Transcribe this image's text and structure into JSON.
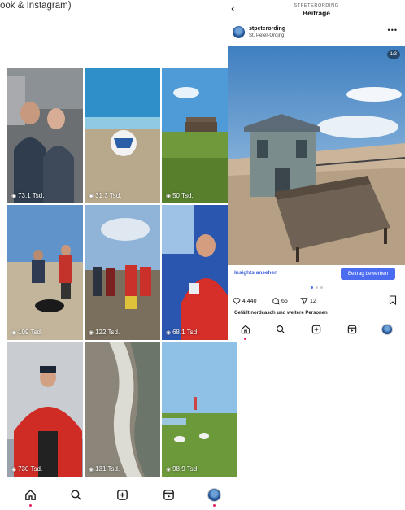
{
  "caption": "ook & Instagram)",
  "grid_phone": {
    "reels": [
      {
        "views": "73,1 Tsd."
      },
      {
        "views": "31,3 Tsd."
      },
      {
        "views": "50 Tsd."
      },
      {
        "views": "109 Tsd."
      },
      {
        "views": "122 Tsd."
      },
      {
        "views": "68,1 Tsd."
      },
      {
        "views": "730 Tsd."
      },
      {
        "views": "131 Tsd."
      },
      {
        "views": "98,9 Tsd."
      }
    ],
    "nav": [
      "home-icon",
      "search-icon",
      "add-icon",
      "reels-icon",
      "profile-avatar"
    ]
  },
  "post_phone": {
    "top_sub": "STPETERORDING",
    "title": "Beiträge",
    "account": "stpeterording",
    "location": "St. Peter-Ording",
    "counter": "1/3",
    "insights": "Insights ansehen",
    "promote": "Beitrag bewerben",
    "likes": "4.440",
    "comments": "66",
    "shares": "12",
    "liked_by": "Gefällt nordcasch und weitere Personen",
    "nav": [
      "home-icon",
      "search-icon",
      "add-icon",
      "reels-icon",
      "profile-avatar"
    ]
  },
  "colors": {
    "accent": "#4b6bf0",
    "link": "#3b5fd6",
    "notify": "#e0245e"
  }
}
